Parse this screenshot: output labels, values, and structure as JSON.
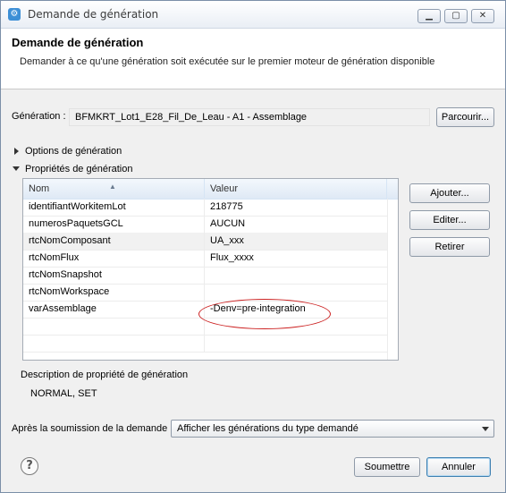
{
  "window": {
    "title": "Demande de génération",
    "controls": {
      "minimize": "▭",
      "maximize": "□",
      "close": "✕"
    }
  },
  "banner": {
    "title": "Demande de génération",
    "description": "Demander à ce qu'une génération soit exécutée sur le premier moteur de génération disponible"
  },
  "generation": {
    "label": "Génération :",
    "value": "BFMKRT_Lot1_E28_Fil_De_Leau - A1 - Assemblage",
    "browse_label": "Parcourir..."
  },
  "sections": {
    "options_label": "Options de génération",
    "properties_label": "Propriétés de génération"
  },
  "table": {
    "columns": [
      "Nom",
      "Valeur"
    ],
    "rows": [
      {
        "name": "identifiantWorkitemLot",
        "value": "218775"
      },
      {
        "name": "numerosPaquetsGCL",
        "value": "AUCUN"
      },
      {
        "name": "rtcNomComposant",
        "value": "UA_xxx"
      },
      {
        "name": "rtcNomFlux",
        "value": "Flux_xxxx"
      },
      {
        "name": "rtcNomSnapshot",
        "value": ""
      },
      {
        "name": "rtcNomWorkspace",
        "value": ""
      },
      {
        "name": "varAssemblage",
        "value": "-Denv=pre-integration"
      }
    ],
    "selected_row": 2
  },
  "side_buttons": {
    "add": "Ajouter...",
    "edit": "Editer...",
    "remove": "Retirer"
  },
  "description": {
    "label": "Description de propriété de génération",
    "value": "NORMAL, SET"
  },
  "after_submit": {
    "label": "Après la soumission de la demande :",
    "selected": "Afficher les générations du type demandé"
  },
  "footer": {
    "submit": "Soumettre",
    "cancel": "Annuler",
    "help_icon": "?"
  },
  "colors": {
    "annotation_oval": "#cc2222",
    "accent": "#3d8fd6"
  }
}
